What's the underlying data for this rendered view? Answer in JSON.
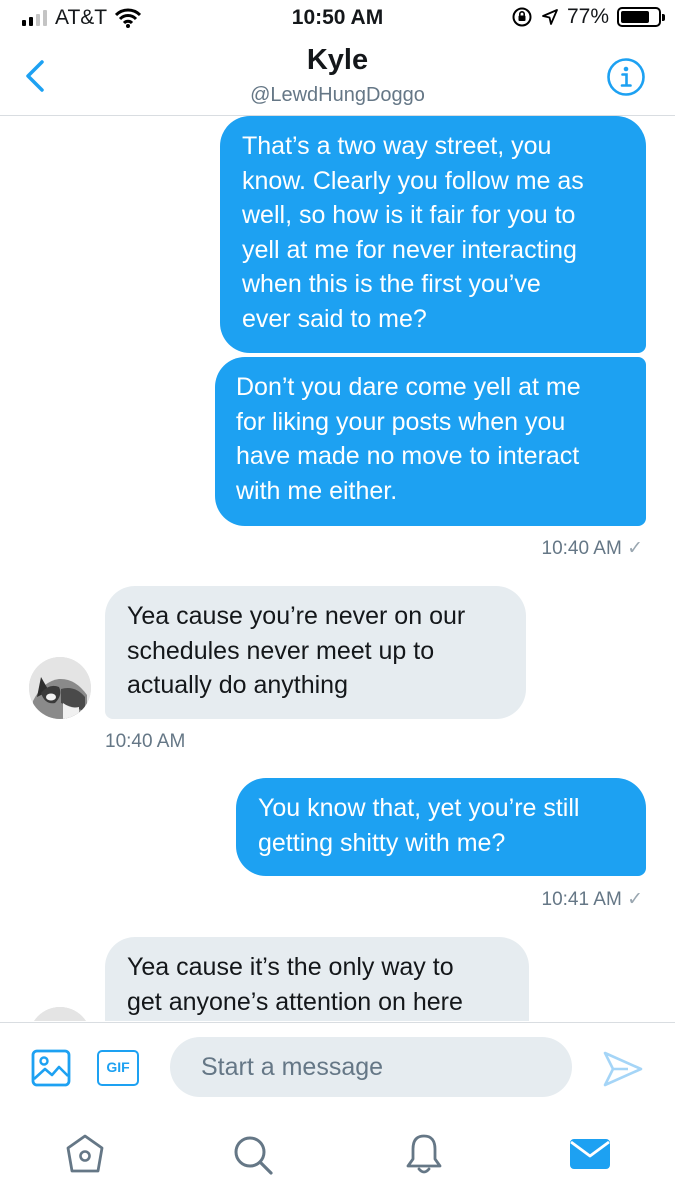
{
  "status_bar": {
    "carrier": "AT&T",
    "time": "10:50 AM",
    "battery": "77%",
    "battery_level": 0.77,
    "signal_bars": 2,
    "icons": [
      "wifi-icon",
      "orientation-lock-icon",
      "location-arrow-icon",
      "battery-icon"
    ]
  },
  "header": {
    "name": "Kyle",
    "handle": "@LewdHungDoggo",
    "back_icon": "chevron-left-icon",
    "info_icon": "info-circle-icon"
  },
  "messages": [
    {
      "direction": "outgoing",
      "lines": [
        "That’s a two way street, you",
        "know. Clearly you follow me as",
        "well, so how is it fair for you to",
        "yell at me for never interacting",
        "when this is the first you’ve",
        "ever said to me?"
      ]
    },
    {
      "direction": "outgoing",
      "lines": [
        "Don’t you dare come yell at me",
        "for liking your posts when you",
        "have made no move to interact",
        "with me either."
      ],
      "timestamp": "10:40 AM",
      "status": "✓"
    },
    {
      "direction": "incoming",
      "lines": [
        "Yea cause you’re never on our",
        "schedules never meet up to",
        "actually do anything"
      ],
      "timestamp": "10:40 AM"
    },
    {
      "direction": "outgoing",
      "lines": [
        "You know that, yet you’re still",
        "getting shitty with me?"
      ],
      "timestamp": "10:41 AM",
      "status": "✓"
    },
    {
      "direction": "incoming",
      "lines": [
        "Yea cause it’s the only way to",
        "get anyone’s attention on here"
      ]
    }
  ],
  "composer": {
    "placeholder": "Start a message",
    "gif_label": "GIF",
    "icons": [
      "image-icon",
      "gif-icon",
      "send-icon"
    ]
  },
  "tab_bar": {
    "tabs": [
      "home-icon",
      "search-icon",
      "notifications-icon",
      "messages-icon"
    ],
    "active": "messages-icon"
  },
  "colors": {
    "accent": "#1da1f2",
    "incoming_bubble": "#e6ecf0",
    "secondary_text": "#657786"
  }
}
